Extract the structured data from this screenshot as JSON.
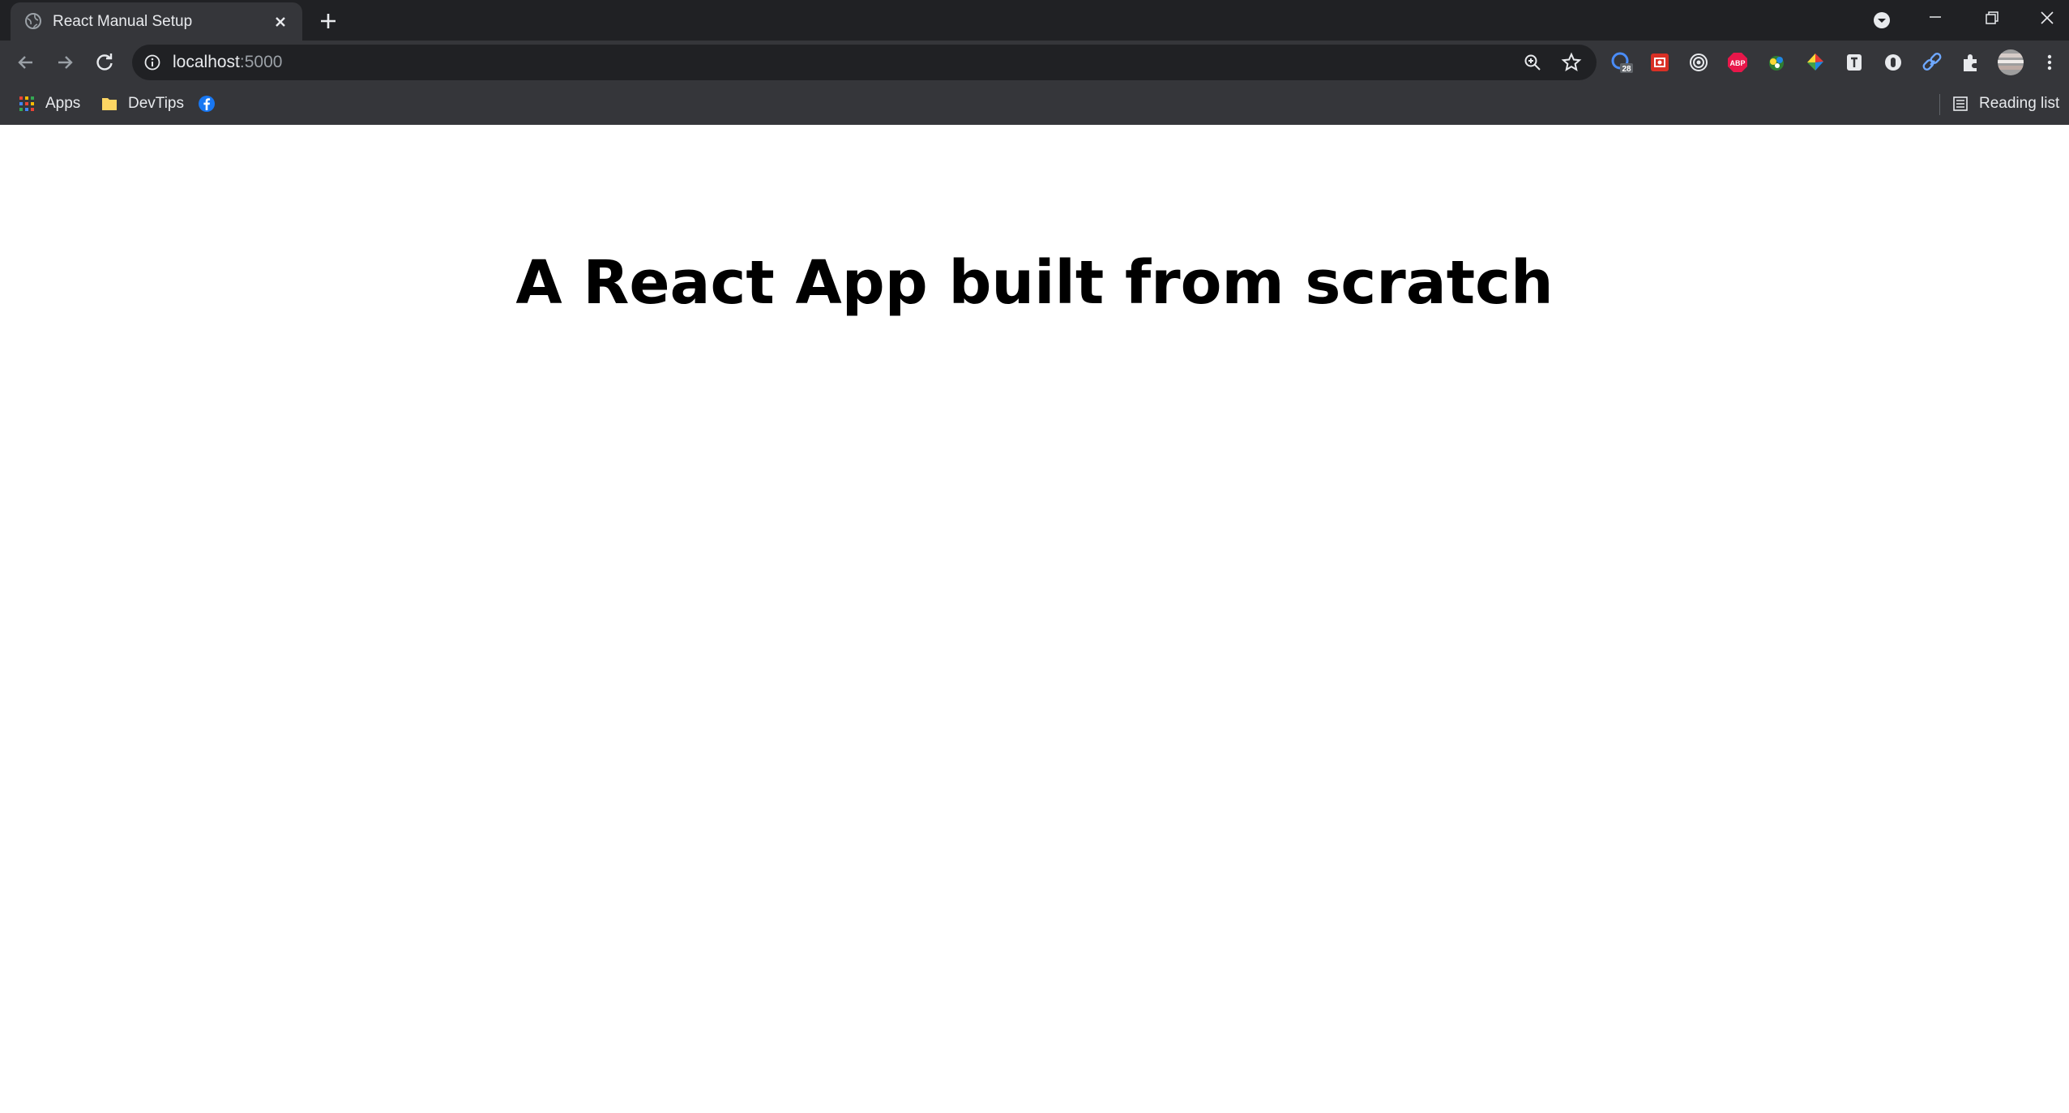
{
  "browser": {
    "tab": {
      "title": "React Manual Setup"
    },
    "address_bar": {
      "host": "localhost",
      "port": ":5000"
    },
    "extensions": [
      {
        "name": "grammar-check-icon",
        "badge": "28"
      },
      {
        "name": "screenshot-extension-icon"
      },
      {
        "name": "target-extension-icon"
      },
      {
        "name": "adblock-plus-icon",
        "text": "ABP"
      },
      {
        "name": "color-picker-icon"
      },
      {
        "name": "colorzilla-icon"
      },
      {
        "name": "text-extension-icon"
      },
      {
        "name": "toggle-extension-icon"
      },
      {
        "name": "link-extension-icon"
      }
    ],
    "bookmarks": [
      {
        "label": "Apps",
        "icon": "apps-grid-icon"
      },
      {
        "label": "DevTips",
        "icon": "folder-icon"
      },
      {
        "label": "",
        "icon": "facebook-icon"
      }
    ],
    "reading_list": "Reading list"
  },
  "page": {
    "heading": "A React App built from scratch"
  },
  "colors": {
    "tabstrip": "#202124",
    "toolbar": "#35363a",
    "omnibox": "#202124",
    "text": "#e8eaed",
    "page_bg": "#ffffff"
  }
}
